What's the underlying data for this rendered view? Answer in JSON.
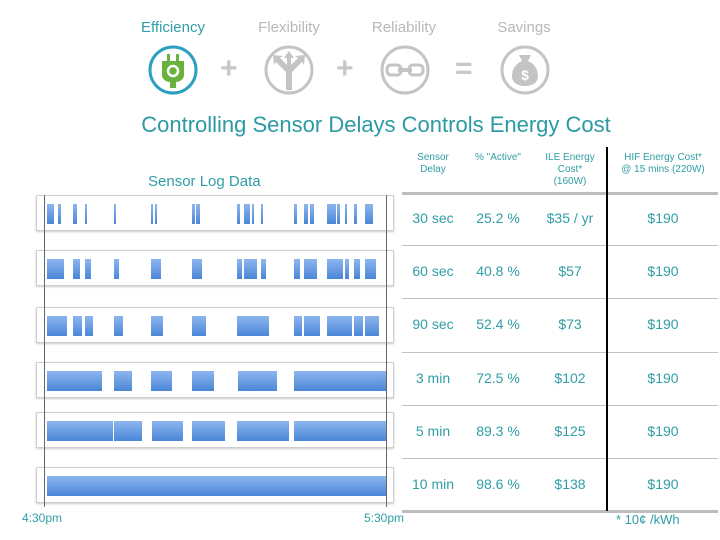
{
  "pillars": [
    {
      "label": "Efficiency",
      "icon": "plug-icon",
      "active": true
    },
    {
      "label": "Flexibility",
      "icon": "branching-arrows-icon",
      "active": false
    },
    {
      "label": "Reliability",
      "icon": "chain-link-icon",
      "active": false
    },
    {
      "label": "Savings",
      "icon": "money-bag-icon",
      "active": false
    }
  ],
  "operators": [
    "+",
    "+",
    "="
  ],
  "title": "Controlling Sensor Delays Controls  Energy Cost",
  "sensor_log": {
    "title": "Sensor Log Data",
    "start_label": "4:30pm",
    "end_label": "5:30pm",
    "range_minutes": [
      0,
      60
    ],
    "rows": [
      {
        "delay": "30 sec",
        "on_intervals_min": [
          [
            0,
            1.4
          ],
          [
            1.9,
            2.6
          ],
          [
            4.5,
            5.4
          ],
          [
            6.7,
            7.3
          ],
          [
            11.8,
            12.4
          ],
          [
            18.3,
            18.9
          ],
          [
            19.0,
            19.6
          ],
          [
            25.5,
            26.2
          ],
          [
            26.3,
            27.1
          ],
          [
            33.5,
            34.1
          ],
          [
            34.7,
            35.9
          ],
          [
            36.0,
            36.6
          ],
          [
            37.6,
            38.2
          ],
          [
            43.5,
            44.2
          ],
          [
            45.2,
            46.1
          ],
          [
            46.2,
            47.2
          ],
          [
            49.3,
            51.0
          ],
          [
            51.1,
            51.7
          ],
          [
            52.4,
            53.0
          ],
          [
            54.1,
            54.7
          ],
          [
            55.9,
            57.5
          ]
        ]
      },
      {
        "delay": "60 sec",
        "on_intervals_min": [
          [
            0,
            3.2
          ],
          [
            4.5,
            5.9
          ],
          [
            6.7,
            7.9
          ],
          [
            11.8,
            12.9
          ],
          [
            18.3,
            20.2
          ],
          [
            25.5,
            27.5
          ],
          [
            33.5,
            34.5
          ],
          [
            34.7,
            37.2
          ],
          [
            37.6,
            38.7
          ],
          [
            43.5,
            44.7
          ],
          [
            45.2,
            47.7
          ],
          [
            49.3,
            52.2
          ],
          [
            52.4,
            53.4
          ],
          [
            54.1,
            55.2
          ],
          [
            55.9,
            58.0
          ]
        ]
      },
      {
        "delay": "90 sec",
        "on_intervals_min": [
          [
            0,
            3.7
          ],
          [
            4.5,
            6.4
          ],
          [
            6.7,
            8.3
          ],
          [
            11.8,
            13.5
          ],
          [
            18.3,
            20.6
          ],
          [
            25.5,
            28.1
          ],
          [
            33.5,
            39.2
          ],
          [
            43.5,
            45.1
          ],
          [
            45.2,
            48.3
          ],
          [
            49.3,
            53.9
          ],
          [
            54.1,
            55.7
          ],
          [
            55.9,
            58.6
          ]
        ]
      },
      {
        "delay": "3 min",
        "on_intervals_min": [
          [
            0,
            9.8
          ],
          [
            11.8,
            15.1
          ],
          [
            18.3,
            22.1
          ],
          [
            25.5,
            29.6
          ],
          [
            33.6,
            40.7
          ],
          [
            43.5,
            60
          ]
        ]
      },
      {
        "delay": "5 min",
        "on_intervals_min": [
          [
            0,
            11.8
          ],
          [
            11.8,
            16.9
          ],
          [
            18.4,
            24.1
          ],
          [
            25.5,
            31.5
          ],
          [
            33.5,
            42.8
          ],
          [
            43.5,
            60
          ]
        ]
      },
      {
        "delay": "10 min",
        "on_intervals_min": [
          [
            0,
            60
          ]
        ]
      }
    ]
  },
  "table": {
    "headers": [
      "Sensor\nDelay",
      "% \"Active\"",
      "ILE Energy\nCost*\n(160W)",
      "HIF Energy Cost*\n@ 15 mins (220W)"
    ],
    "rows": [
      [
        "30 sec",
        "25.2 %",
        "$35 / yr",
        "$190"
      ],
      [
        "60 sec",
        "40.8 %",
        "$57",
        "$190"
      ],
      [
        "90 sec",
        "52.4 %",
        "$73",
        "$190"
      ],
      [
        "3 min",
        "72.5 %",
        "$102",
        "$190"
      ],
      [
        "5 min",
        "89.3 %",
        "$125",
        "$190"
      ],
      [
        "10 min",
        "98.6 %",
        "$138",
        "$190"
      ]
    ],
    "footnote": "* 10¢ /kWh"
  },
  "colors": {
    "accent": "#2f9ea6",
    "bar": "#4a86d8",
    "efficiency_green": "#6ab23e",
    "inactive": "#c4c4c4"
  }
}
